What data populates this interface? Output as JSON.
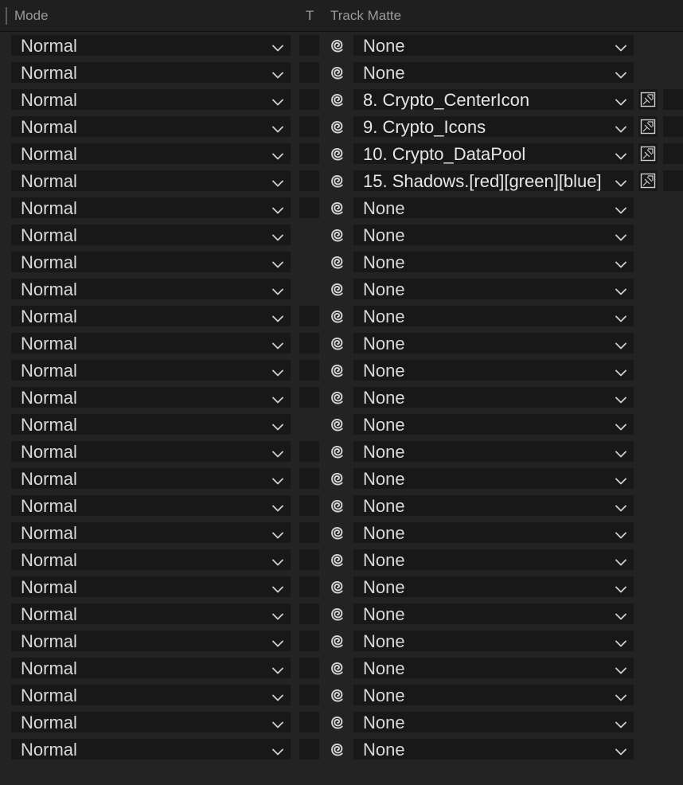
{
  "header": {
    "mode_label": "Mode",
    "t_label": "T",
    "matte_label": "Track Matte"
  },
  "icons": {
    "chevron": "chevron-down-icon",
    "pickwhip": "pickwhip-spiral-icon",
    "invert": "matte-invert-icon"
  },
  "rows": [
    {
      "mode": "Normal",
      "t_box": true,
      "matte": "None",
      "matte_set": false
    },
    {
      "mode": "Normal",
      "t_box": true,
      "matte": "None",
      "matte_set": false
    },
    {
      "mode": "Normal",
      "t_box": true,
      "matte": "8. Crypto_CenterIcon",
      "matte_set": true
    },
    {
      "mode": "Normal",
      "t_box": true,
      "matte": "9. Crypto_Icons",
      "matte_set": true
    },
    {
      "mode": "Normal",
      "t_box": true,
      "matte": "10. Crypto_DataPool",
      "matte_set": true
    },
    {
      "mode": "Normal",
      "t_box": true,
      "matte": "15. Shadows.[red][green][blue]",
      "matte_set": true
    },
    {
      "mode": "Normal",
      "t_box": true,
      "matte": "None",
      "matte_set": false
    },
    {
      "mode": "Normal",
      "t_box": false,
      "matte": "None",
      "matte_set": false
    },
    {
      "mode": "Normal",
      "t_box": false,
      "matte": "None",
      "matte_set": false
    },
    {
      "mode": "Normal",
      "t_box": false,
      "matte": "None",
      "matte_set": false
    },
    {
      "mode": "Normal",
      "t_box": true,
      "matte": "None",
      "matte_set": false
    },
    {
      "mode": "Normal",
      "t_box": true,
      "matte": "None",
      "matte_set": false
    },
    {
      "mode": "Normal",
      "t_box": true,
      "matte": "None",
      "matte_set": false
    },
    {
      "mode": "Normal",
      "t_box": true,
      "matte": "None",
      "matte_set": false
    },
    {
      "mode": "Normal",
      "t_box": false,
      "matte": "None",
      "matte_set": false
    },
    {
      "mode": "Normal",
      "t_box": true,
      "matte": "None",
      "matte_set": false
    },
    {
      "mode": "Normal",
      "t_box": true,
      "matte": "None",
      "matte_set": false
    },
    {
      "mode": "Normal",
      "t_box": true,
      "matte": "None",
      "matte_set": false
    },
    {
      "mode": "Normal",
      "t_box": true,
      "matte": "None",
      "matte_set": false
    },
    {
      "mode": "Normal",
      "t_box": true,
      "matte": "None",
      "matte_set": false
    },
    {
      "mode": "Normal",
      "t_box": true,
      "matte": "None",
      "matte_set": false
    },
    {
      "mode": "Normal",
      "t_box": true,
      "matte": "None",
      "matte_set": false
    },
    {
      "mode": "Normal",
      "t_box": true,
      "matte": "None",
      "matte_set": false
    },
    {
      "mode": "Normal",
      "t_box": true,
      "matte": "None",
      "matte_set": false
    },
    {
      "mode": "Normal",
      "t_box": true,
      "matte": "None",
      "matte_set": false
    },
    {
      "mode": "Normal",
      "t_box": true,
      "matte": "None",
      "matte_set": false
    },
    {
      "mode": "Normal",
      "t_box": true,
      "matte": "None",
      "matte_set": false
    }
  ],
  "colors": {
    "panel_bg": "#232323",
    "field_bg": "#181818",
    "text": "#d9d9d9",
    "header_text": "#9a9a9a"
  }
}
